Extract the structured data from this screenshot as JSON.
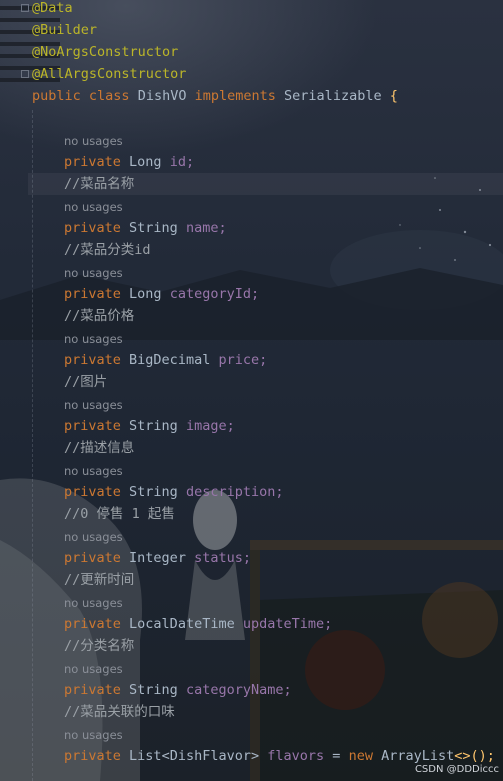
{
  "annotations": [
    "@Data",
    "@Builder",
    "@NoArgsConstructor",
    "@AllArgsConstructor"
  ],
  "class_decl": {
    "public": "public",
    "class": "class",
    "name": "DishVO",
    "implements": "implements",
    "iface": "Serializable",
    "brace": "{"
  },
  "usage_hint": "no usages",
  "keywords": {
    "private": "private",
    "new": "new"
  },
  "fields": [
    {
      "type": "Long",
      "name": "id;"
    },
    {
      "type": "String",
      "name": "name;"
    },
    {
      "type": "Long",
      "name": "categoryId;"
    },
    {
      "type": "BigDecimal",
      "name": "price;"
    },
    {
      "type": "String",
      "name": "image;"
    },
    {
      "type": "String",
      "name": "description;"
    },
    {
      "type": "Integer",
      "name": "status;"
    },
    {
      "type": "LocalDateTime",
      "name": "updateTime;"
    },
    {
      "type": "String",
      "name": "categoryName;"
    }
  ],
  "comments": [
    "//菜品名称",
    "//菜品分类id",
    "//菜品价格",
    "//图片",
    "//描述信息",
    "//0 停售 1 起售",
    "//更新时间",
    "//分类名称",
    "//菜品关联的口味"
  ],
  "last_field": {
    "type_a": "List",
    "lt": "<",
    "generic": "DishFlavor",
    "gt": ">",
    "name": "flavors",
    "eq": " = ",
    "ctor": "ArrayList",
    "tail": "<>();"
  },
  "watermark": "CSDN @DDDiccc"
}
